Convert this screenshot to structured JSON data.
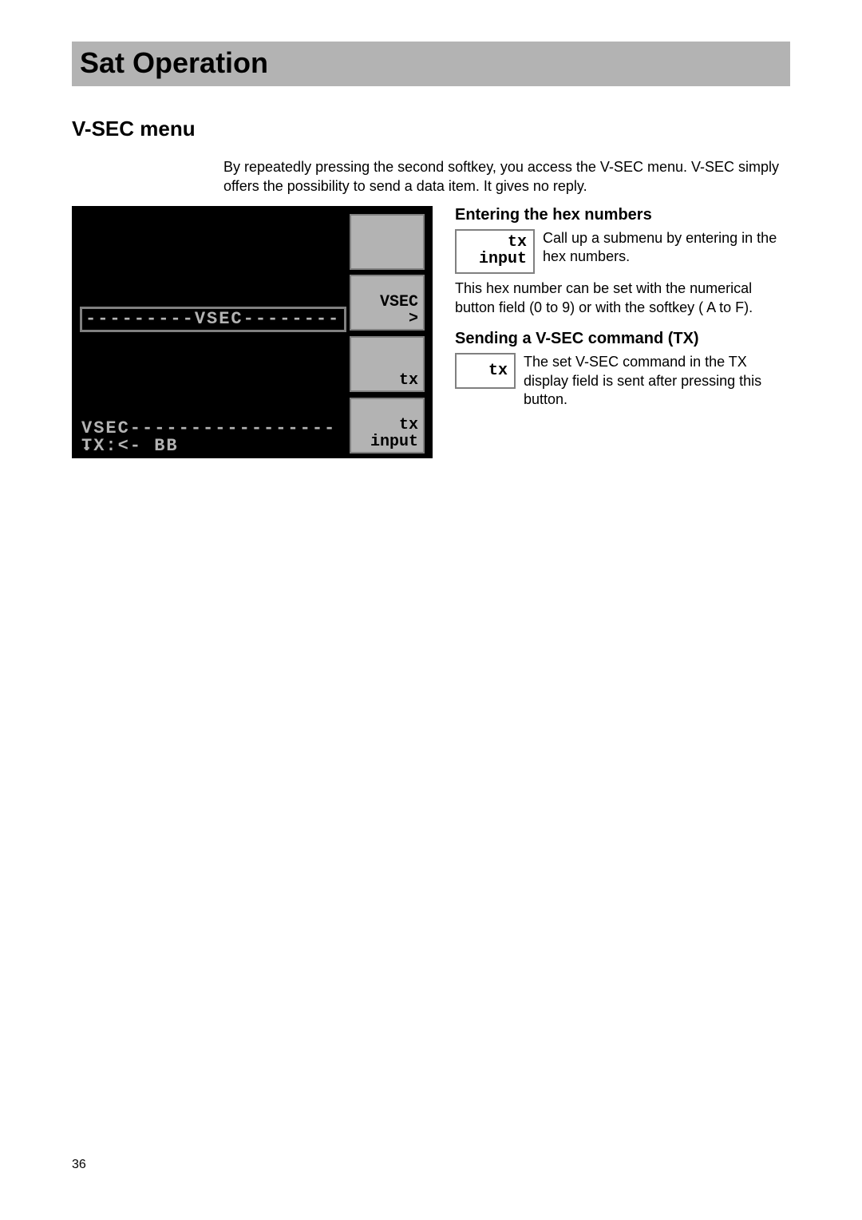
{
  "banner": {
    "title": "Sat Operation"
  },
  "section": {
    "title": "V-SEC menu"
  },
  "intro": "By repeatedly pressing the second softkey, you access the V-SEC menu. V-SEC simply offers the possibility to send a data item. It gives no reply.",
  "device": {
    "row_vsec_mid": "---------VSEC--------",
    "row_bottom_vsec": "VSEC------------------",
    "row_bottom_tx": "TX:<- BB",
    "softkeys": [
      {
        "line1": "",
        "line2": ""
      },
      {
        "line1": "VSEC",
        "line2": ">"
      },
      {
        "line1": "",
        "line2": "tx"
      },
      {
        "line1": "tx",
        "line2": "input"
      }
    ]
  },
  "right": {
    "hex": {
      "heading": "Entering the hex numbers",
      "btn_line1": "tx",
      "btn_line2": "input",
      "text1": "Call up a submenu by entering in the hex numbers.",
      "text2": "This hex number can be set with the numerical button field (0 to 9) or with the softkey ( A to F)."
    },
    "send": {
      "heading": "Sending a V-SEC command (TX)",
      "btn_line1": "tx",
      "text1": "The set V-SEC command in the TX display field is sent after pressing this button."
    }
  },
  "page_number": "36"
}
